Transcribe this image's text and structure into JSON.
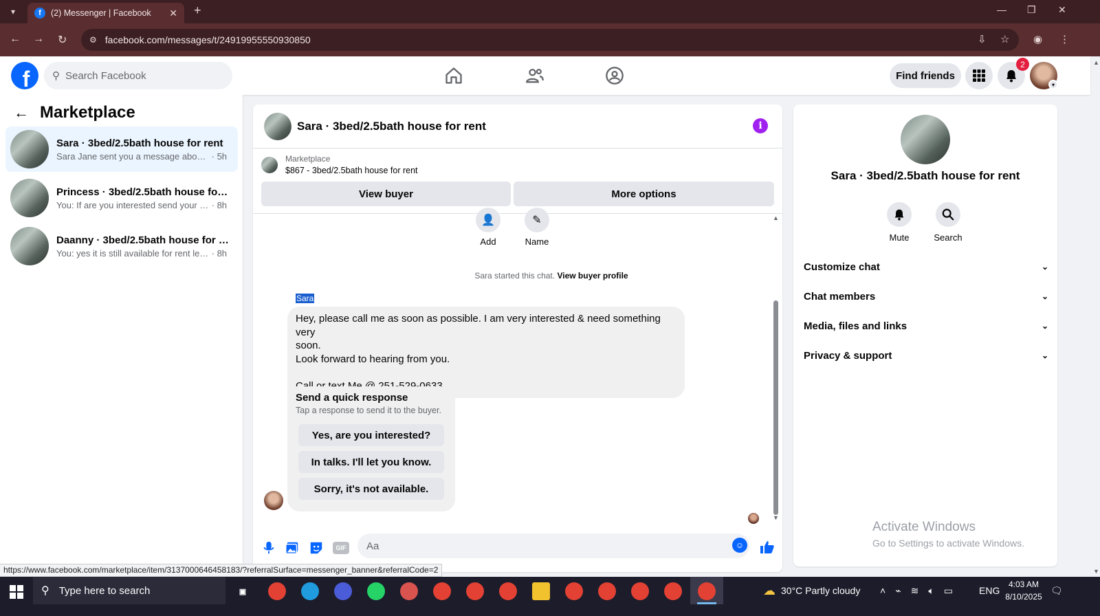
{
  "browser": {
    "tab_title": "(2) Messenger | Facebook",
    "url": "facebook.com/messages/t/24919955550930850"
  },
  "header": {
    "search_placeholder": "Search Facebook",
    "find_friends_label": "Find friends",
    "notification_count": "2"
  },
  "sidebar": {
    "title": "Marketplace",
    "conversations": [
      {
        "name": "Sara · 3bed/2.5bath house for rent",
        "preview": "Sara Jane sent you a message about y...",
        "time": "· 5h",
        "active": true
      },
      {
        "name": "Princess · 3bed/2.5bath house for ...",
        "preview": "You: If are you interested send your n...",
        "time": "· 8h",
        "active": false
      },
      {
        "name": "Daanny · 3bed/2.5bath house for r...",
        "preview": "You: yes it is still available for rent let ...",
        "time": "· 8h",
        "active": false
      }
    ]
  },
  "chat": {
    "title": "Sara · 3bed/2.5bath house for rent",
    "listing_source": "Marketplace",
    "listing_title": "$867 - 3bed/2.5bath house for rent",
    "view_buyer_label": "View buyer",
    "more_options_label": "More options",
    "mini_actions": [
      {
        "label": "Add"
      },
      {
        "label": "Name"
      }
    ],
    "started_text": "Sara started this chat.",
    "started_link": "View buyer profile",
    "sender_name": "Sara",
    "message_lines": [
      "Hey, please call me as soon as possible. I am very interested & need something very",
      "soon.",
      "Look forward to hearing from you.",
      "",
      "Call or text Me @ 251-529-0633"
    ],
    "quick_title": "Send a quick response",
    "quick_subtitle": "Tap a response to send it to the buyer.",
    "quick_responses": [
      "Yes, are you interested?",
      "In talks. I'll let you know.",
      "Sorry, it's not available."
    ],
    "composer_placeholder": "Aa",
    "composer_gif_label": "GIF"
  },
  "info_panel": {
    "name": "Sara · 3bed/2.5bath house for rent",
    "actions": [
      {
        "label": "Mute",
        "icon": "bell-icon"
      },
      {
        "label": "Search",
        "icon": "search-icon"
      }
    ],
    "sections": [
      "Customize chat",
      "Chat members",
      "Media, files and links",
      "Privacy & support"
    ]
  },
  "watermark": {
    "line1": "Activate Windows",
    "line2": "Go to Settings to activate Windows."
  },
  "status_url": "https://www.facebook.com/marketplace/item/3137000646458183/?referralSurface=messenger_banner&referralCode=2",
  "taskbar": {
    "search_placeholder": "Type here to search",
    "weather": "30°C  Partly cloudy",
    "language": "ENG",
    "time": "4:03 AM",
    "date": "8/10/2025"
  },
  "colors": {
    "fb_blue": "#0866ff",
    "info_purple": "#a020f0",
    "badge_red": "#e41e3f",
    "chrome_dark": "#3c1f22"
  }
}
